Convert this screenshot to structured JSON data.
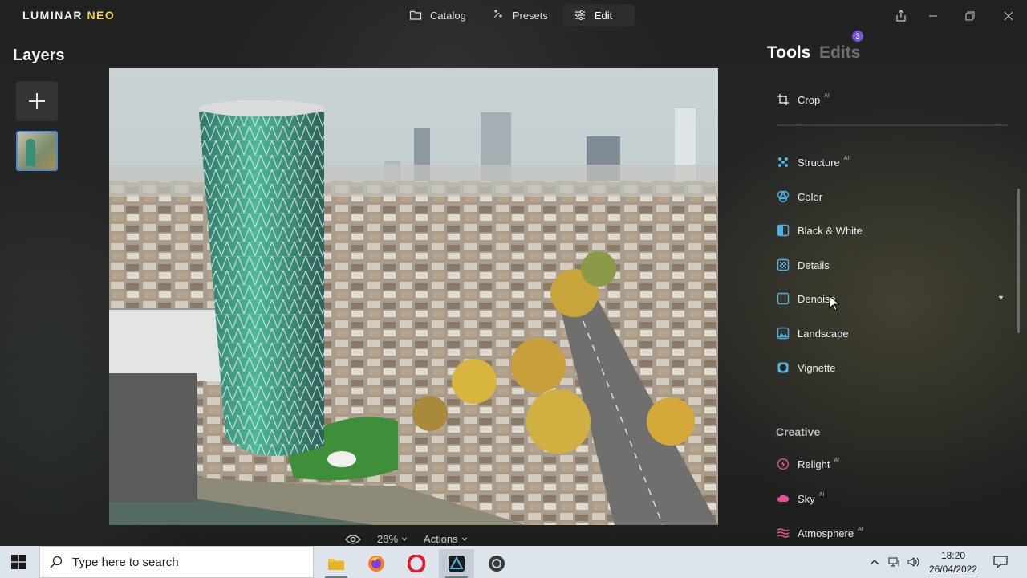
{
  "app": {
    "logo_main": "LUMINAR",
    "logo_accent": "NEO"
  },
  "nav": {
    "catalog": "Catalog",
    "presets": "Presets",
    "edit": "Edit"
  },
  "layers": {
    "title": "Layers"
  },
  "bottom_bar": {
    "zoom": "28%",
    "actions": "Actions"
  },
  "panel": {
    "tab_tools": "Tools",
    "tab_edits": "Edits",
    "edits_count": "3",
    "ai_badge": "AI",
    "tools": [
      {
        "label": "Crop",
        "icon": "crop-icon",
        "ai": true
      },
      {
        "label": "Structure",
        "icon": "structure-icon",
        "ai": true
      },
      {
        "label": "Color",
        "icon": "color-icon",
        "ai": false
      },
      {
        "label": "Black & White",
        "icon": "black-white-icon",
        "ai": false
      },
      {
        "label": "Details",
        "icon": "details-icon",
        "ai": false
      },
      {
        "label": "Denoise",
        "icon": "denoise-icon",
        "ai": false
      },
      {
        "label": "Landscape",
        "icon": "landscape-icon",
        "ai": false
      },
      {
        "label": "Vignette",
        "icon": "vignette-icon",
        "ai": false
      }
    ],
    "creative_title": "Creative",
    "creative_tools": [
      {
        "label": "Relight",
        "icon": "relight-icon",
        "ai": true
      },
      {
        "label": "Sky",
        "icon": "sky-icon",
        "ai": true
      },
      {
        "label": "Atmosphere",
        "icon": "atmosphere-icon",
        "ai": true
      }
    ]
  },
  "taskbar": {
    "search_placeholder": "Type here to search",
    "time": "18:20",
    "date": "26/04/2022"
  },
  "colors": {
    "accent_blue": "#4a8be0",
    "logo_yellow": "#f2d34a",
    "badge_purple": "#7b55d8",
    "creative_pink": "#e8509a"
  }
}
